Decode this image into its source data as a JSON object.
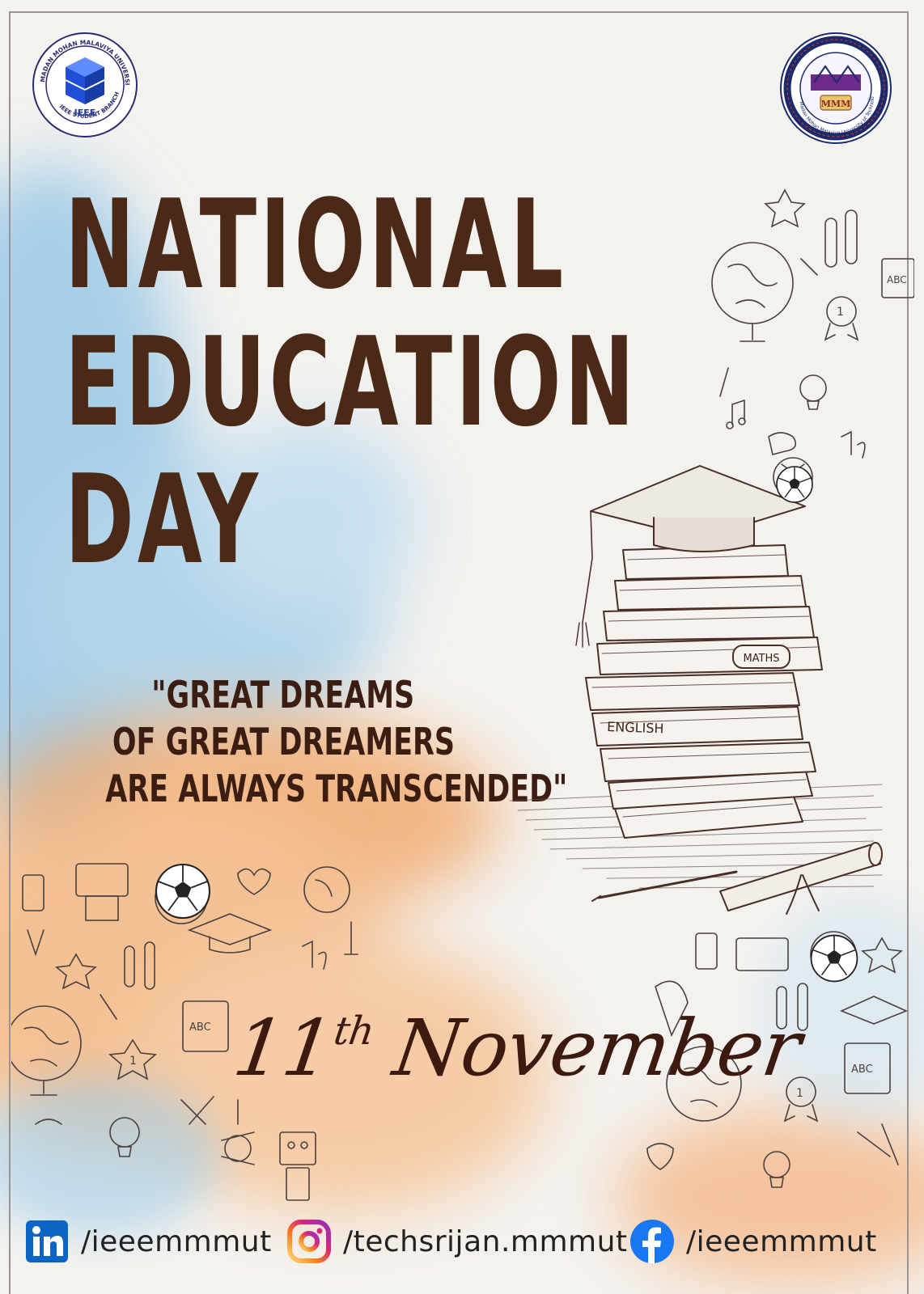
{
  "logos": {
    "left_text": "MADAN MOHAN MALAVIYA UNIVERSITY OF TECHNOLOGY GORAKHPUR",
    "left_brand": "IEEE",
    "left_sub": "IEEE STUDENT BRANCH",
    "right_text": "Madan Mohan Malaviya University of Technology, Gorakhpur"
  },
  "title": {
    "line1": "NATIONAL",
    "line2": "EDUCATION",
    "line3": "DAY"
  },
  "quote": {
    "line1": "\"GREAT DREAMS",
    "line2": "OF GREAT DREAMERS",
    "line3": "ARE ALWAYS TRANSCENDED\""
  },
  "date": {
    "day": "11",
    "suffix": "th",
    "month": "November"
  },
  "book_labels": {
    "maths": "MATHS",
    "english": "ENGLISH"
  },
  "doodle_labels": {
    "abc": "ABC",
    "rank": "1"
  },
  "social": [
    {
      "icon": "linkedin-icon",
      "handle": "/ieeemmmut"
    },
    {
      "icon": "instagram-icon",
      "handle": "/techsrijan.mmmut"
    },
    {
      "icon": "facebook-icon",
      "handle": "/ieeemmmut"
    }
  ],
  "colors": {
    "title": "#4a2a16",
    "quote": "#3b1d12",
    "blue_wash": "#8fc3e6",
    "orange_wash": "#f2a86a",
    "ieee_blue": "#1f4fd8",
    "linkedin": "#0a66c2",
    "facebook": "#1877f2"
  }
}
